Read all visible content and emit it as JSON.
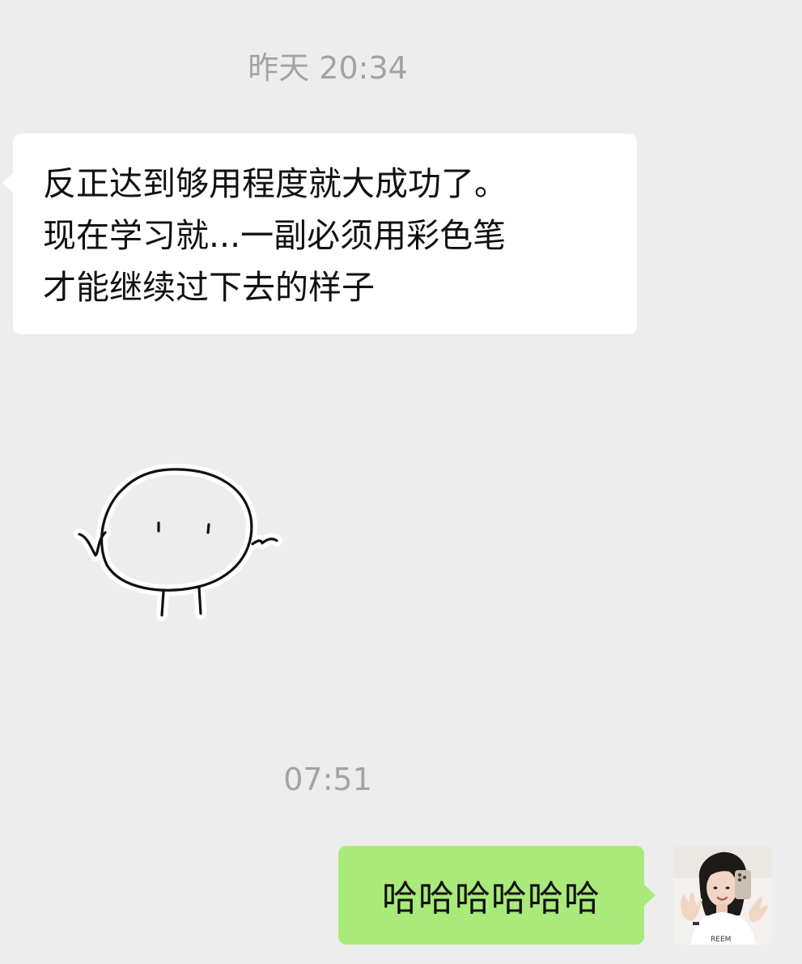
{
  "chat": {
    "timestamp_1": "昨天 20:34",
    "timestamp_2": "07:51",
    "incoming_message": {
      "line_1": "反正达到够用程度就大成功了。",
      "line_2": "现在学习就...一副必须用彩色笔",
      "line_3": "才能继续过下去的样子"
    },
    "sticker": "shrugging-doodle-sticker",
    "outgoing_message": "哈哈哈哈哈哈",
    "avatar": "user-selfie-avatar"
  },
  "colors": {
    "background": "#ededed",
    "incoming_bubble": "#ffffff",
    "outgoing_bubble": "#a9ea7a",
    "timestamp_text": "#a3a3a3",
    "message_text": "#111111"
  }
}
